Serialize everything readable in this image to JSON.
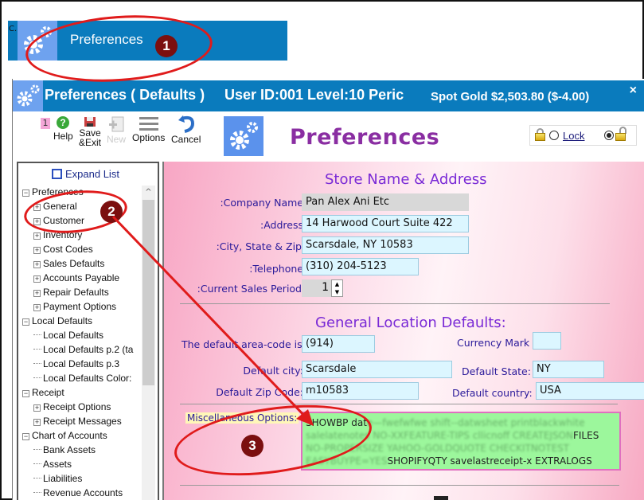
{
  "launcher": {
    "corner_text": "C.",
    "label": "Preferences",
    "icon": "gear-icon"
  },
  "window": {
    "title": "Preferences ( Defaults )",
    "user_info": "User ID:001 Level:10 Peric",
    "spot_gold": "Spot Gold $2,503.80 ($-4.00)",
    "close_glyph": "×"
  },
  "toolbar": {
    "badge": "1",
    "help": "Help",
    "save_line1": "Save",
    "save_line2": "&Exit",
    "new": "New",
    "options": "Options",
    "cancel": "Cancel"
  },
  "header": {
    "title": "Preferences"
  },
  "lock": {
    "label": "Lock",
    "locked_selected": false,
    "unlocked_selected": true
  },
  "tree": {
    "expand_label": "Expand List",
    "nodes": [
      {
        "label": "Preferences",
        "level": 0,
        "toggle": "-"
      },
      {
        "label": "General",
        "level": 1,
        "toggle": "+"
      },
      {
        "label": "Customer",
        "level": 1,
        "toggle": "+"
      },
      {
        "label": "Inventory",
        "level": 1,
        "toggle": "+"
      },
      {
        "label": "Cost Codes",
        "level": 1,
        "toggle": "+"
      },
      {
        "label": "Sales Defaults",
        "level": 1,
        "toggle": "+"
      },
      {
        "label": "Accounts Payable",
        "level": 1,
        "toggle": "+"
      },
      {
        "label": "Repair Defaults",
        "level": 1,
        "toggle": "+"
      },
      {
        "label": "Payment Options",
        "level": 1,
        "toggle": "+"
      },
      {
        "label": "Local Defaults",
        "level": 0,
        "toggle": "-"
      },
      {
        "label": "Local Defaults",
        "level": 1,
        "toggle": ""
      },
      {
        "label": "Local Defaults p.2 (ta",
        "level": 1,
        "toggle": ""
      },
      {
        "label": "Local Defaults p.3",
        "level": 1,
        "toggle": ""
      },
      {
        "label": "Local Defaults Color:",
        "level": 1,
        "toggle": ""
      },
      {
        "label": "Receipt",
        "level": 0,
        "toggle": "-"
      },
      {
        "label": "Receipt Options",
        "level": 1,
        "toggle": "+"
      },
      {
        "label": "Receipt Messages",
        "level": 1,
        "toggle": "+"
      },
      {
        "label": "Chart of Accounts",
        "level": 0,
        "toggle": "-"
      },
      {
        "label": "Bank Assets",
        "level": 1,
        "toggle": ""
      },
      {
        "label": "Assets",
        "level": 1,
        "toggle": ""
      },
      {
        "label": "Liabilities",
        "level": 1,
        "toggle": ""
      },
      {
        "label": "Revenue Accounts",
        "level": 1,
        "toggle": ""
      }
    ]
  },
  "store": {
    "title": "Store Name & Address",
    "company_label": ":Company Name",
    "company_value": "Pan Alex Ani Etc",
    "address_label": ":Address",
    "address_value": "14 Harwood Court Suite 422",
    "city_label": ":City, State & Zip",
    "city_value": "Scarsdale, NY 10583",
    "phone_label": ":Telephone",
    "phone_value": "(310) 204-5123",
    "period_label": ":Current Sales Period",
    "period_value": "1"
  },
  "location": {
    "title": "General Location Defaults:",
    "area_label": "The default area-code is:",
    "area_value": "(914)",
    "currency_label": "Currency Mark",
    "currency_value": "",
    "city_label": "Default city:",
    "city_value": "Scarsdale",
    "state_label": "Default State:",
    "state_value": "NY",
    "zip_label": "Default Zip Code:",
    "zip_value": "m10583",
    "country_label": "Default country:",
    "country_value": "USA"
  },
  "misc": {
    "label": "Miscellaneous Options:",
    "value_visible_start": "SHOWBP dat",
    "value_blurred_1": "e—fwefwfwe shift--datwsheet printblackwhite salelatenotes NO-XXFEATURE-TIPS cllicnoff CREATEJSON",
    "value_visible_mid": "FILES",
    "value_blurred_2": "NO-PROPERSIZE YAHOO-GOLDQUOTE CHECKITNOTEST EASYBUYPE=YES",
    "value_visible_end": "SHOPIFYQTY savelastreceipt-x EXTRALOGS"
  },
  "annotations": {
    "step1": "1",
    "step2": "2",
    "step3": "3"
  },
  "colors": {
    "title_bar": "#0a7bbd",
    "accent_purple": "#8a2ea2",
    "annotation_red": "#e01b1b"
  }
}
